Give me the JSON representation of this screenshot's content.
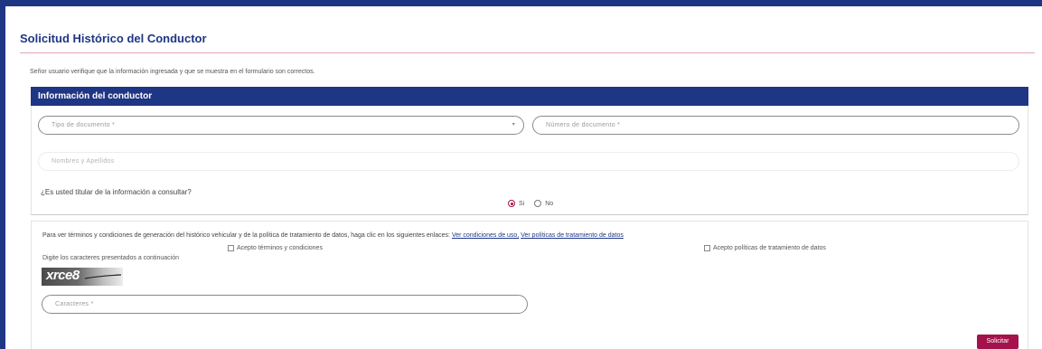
{
  "page": {
    "title": "Solicitud Histórico del Conductor",
    "notice": "Señor usuario verifique que la información ingresada y que se muestra en el formulario son correctos."
  },
  "section": {
    "header": "Información del conductor"
  },
  "fields": {
    "document_type": {
      "placeholder": "Tipo de documento *"
    },
    "document_number": {
      "placeholder": "Número de documento *"
    },
    "full_name": {
      "placeholder": "Nombres y Apellidos"
    }
  },
  "holder_question": {
    "text": "¿Es usted titular de la información a consultar?",
    "options": [
      {
        "label": "Si",
        "checked": true
      },
      {
        "label": "No",
        "checked": false
      }
    ]
  },
  "terms": {
    "text": "Para ver términos y condiciones de generación del histórico vehicular y de la política de tratamiento de datos, haga clic en los siguientes enlaces:",
    "link_conditions": "Ver condiciones de uso,",
    "link_policies": "Ver políticas de tratamiento de datos",
    "accept_terms": "Acepto términos y condiciones",
    "accept_policies": "Acepto políticas de tratamiento de datos"
  },
  "captcha": {
    "label": "Digite los caracteres presentados a continuación",
    "image_text": "xrce8",
    "input_placeholder": "Caracteres *"
  },
  "actions": {
    "submit_label": "Solicitar"
  },
  "colors": {
    "primary": "#1f3685",
    "accent": "#a3124b",
    "rule": "#e4a3b2"
  }
}
